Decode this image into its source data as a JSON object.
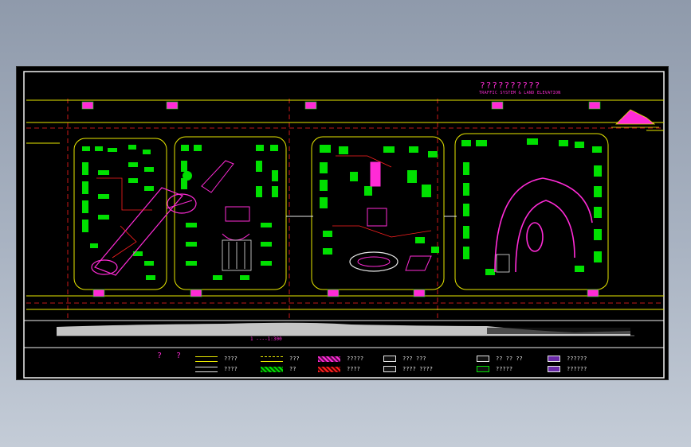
{
  "title": "??????????",
  "subtitle": "TRAFFIC SYSTEM & LAND ELEVATION",
  "scale_note": "1 ----1:300",
  "legend": {
    "heading": "? ?",
    "items": [
      {
        "label": "????",
        "swatch": "yellow-lines"
      },
      {
        "label": "????",
        "swatch": "white-lines"
      },
      {
        "label": "???",
        "swatch": "yellow-dash"
      },
      {
        "label": "??",
        "swatch": "green-hatch"
      },
      {
        "label": "?????",
        "swatch": "magenta-hatch"
      },
      {
        "label": "????",
        "swatch": "red-hatch"
      },
      {
        "label": "??? ???",
        "swatch": "arrow-box"
      },
      {
        "label": "???? ????",
        "swatch": "arrow-box"
      },
      {
        "label": "?? ?? ??",
        "swatch": "parking-icon"
      },
      {
        "label": "?????",
        "swatch": "tree-icon"
      },
      {
        "label": "??????",
        "swatch": "purple-box"
      },
      {
        "label": "??????",
        "swatch": "purple-box"
      }
    ]
  },
  "colors": {
    "background": "#000000",
    "road_edge": "#e8e800",
    "building": "#00e000",
    "amenity": "#ff2bd6",
    "red_line": "#ff2020",
    "text": "#e6e6e6",
    "frame": "#f0f0f0"
  }
}
